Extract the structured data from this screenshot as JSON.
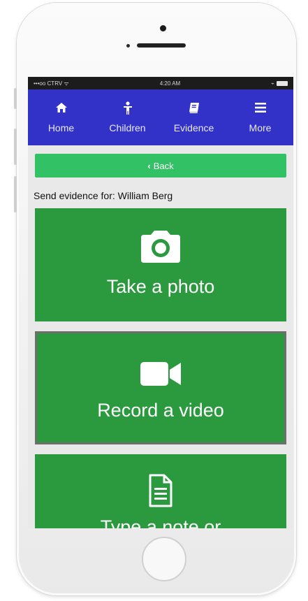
{
  "status_bar": {
    "carrier": "•••oo CTRV ᯤ",
    "time": "4:20 AM",
    "right": "⌁"
  },
  "nav": {
    "items": [
      {
        "label": "Home",
        "icon": "home-icon"
      },
      {
        "label": "Children",
        "icon": "child-icon"
      },
      {
        "label": "Evidence",
        "icon": "book-icon"
      },
      {
        "label": "More",
        "icon": "menu-icon"
      }
    ]
  },
  "back_label": "Back",
  "send_label": "Send evidence for: William Berg",
  "tiles": [
    {
      "label": "Take a photo",
      "icon": "camera-icon"
    },
    {
      "label": "Record a video",
      "icon": "video-camera-icon"
    },
    {
      "label": "Type a note or",
      "icon": "document-icon"
    }
  ],
  "colors": {
    "nav": "#3232c8",
    "back": "#33c165",
    "tile": "#2b9a3f"
  }
}
